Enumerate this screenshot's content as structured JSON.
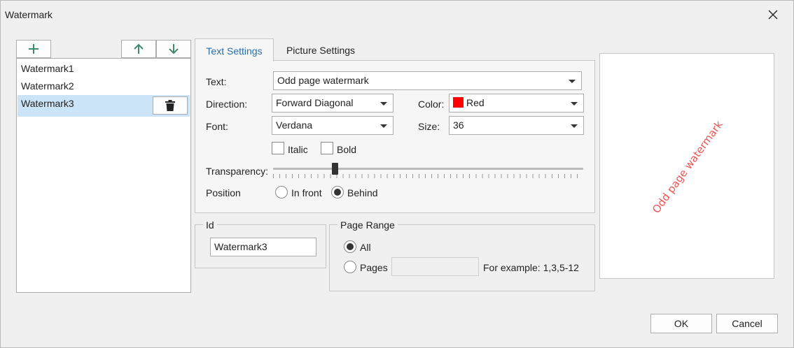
{
  "window": {
    "title": "Watermark",
    "close_icon": "close-icon"
  },
  "toolbar": {
    "add_icon": "plus-icon",
    "up_icon": "arrow-up-icon",
    "down_icon": "arrow-down-icon",
    "delete_icon": "trash-icon"
  },
  "watermarks": {
    "items": [
      {
        "label": "Watermark1",
        "selected": false
      },
      {
        "label": "Watermark2",
        "selected": false
      },
      {
        "label": "Watermark3",
        "selected": true
      }
    ]
  },
  "tabs": [
    {
      "label": "Text Settings",
      "active": true
    },
    {
      "label": "Picture Settings",
      "active": false
    }
  ],
  "text_settings": {
    "text_label": "Text:",
    "text_value": "Odd page watermark",
    "direction_label": "Direction:",
    "direction_value": "Forward Diagonal",
    "color_label": "Color:",
    "color_value": "Red",
    "color_hex": "#ff0000",
    "font_label": "Font:",
    "font_value": "Verdana",
    "size_label": "Size:",
    "size_value": "36",
    "italic_label": "Italic",
    "italic_checked": false,
    "bold_label": "Bold",
    "bold_checked": false,
    "transparency_label": "Transparency:",
    "transparency_fraction": 0.2,
    "position_label": "Position",
    "in_front_label": "In front",
    "behind_label": "Behind",
    "position_selected": "Behind"
  },
  "id_group": {
    "legend": "Id",
    "value": "Watermark3"
  },
  "page_range": {
    "legend": "Page Range",
    "all_label": "All",
    "pages_label": "Pages",
    "pages_value": "",
    "example_text": "For example: 1,3,5-12",
    "selected": "All"
  },
  "preview": {
    "text": "Odd page watermark",
    "color": "#f05454"
  },
  "buttons": {
    "ok": "OK",
    "cancel": "Cancel"
  }
}
